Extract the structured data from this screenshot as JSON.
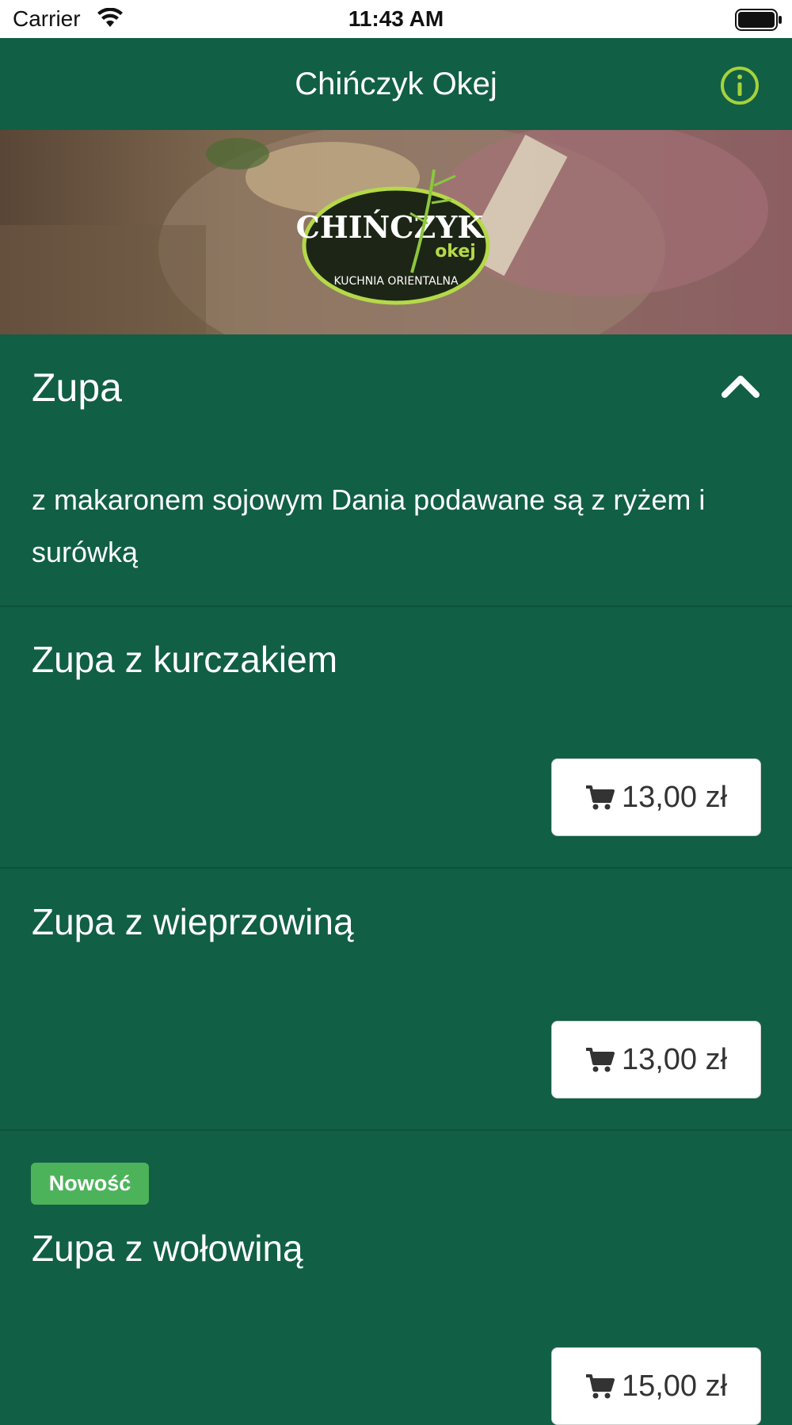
{
  "status_bar": {
    "carrier": "Carrier",
    "time": "11:43 AM"
  },
  "nav": {
    "title": "Chińczyk Okej",
    "info_icon": "info-circle-icon"
  },
  "banner": {
    "logo_text_main": "CHIŃCZYK",
    "logo_text_sub": "okej",
    "logo_text_tagline": "KUCHNIA ORIENTALNA"
  },
  "category": {
    "title": "Zupa",
    "description": "z makaronem sojowym Dania podawane są z ryżem i surówką",
    "collapse_icon": "chevron-up-icon"
  },
  "items": [
    {
      "name": "Zupa z kurczakiem",
      "price": "13,00 zł",
      "badge": ""
    },
    {
      "name": "Zupa z wieprzowiną",
      "price": "13,00 zł",
      "badge": ""
    },
    {
      "name": "Zupa z wołowiną",
      "price": "15,00 zł",
      "badge": "Nowość"
    }
  ],
  "colors": {
    "background": "#115f45",
    "accent": "#a6d23a",
    "badge": "#4cb35a"
  }
}
